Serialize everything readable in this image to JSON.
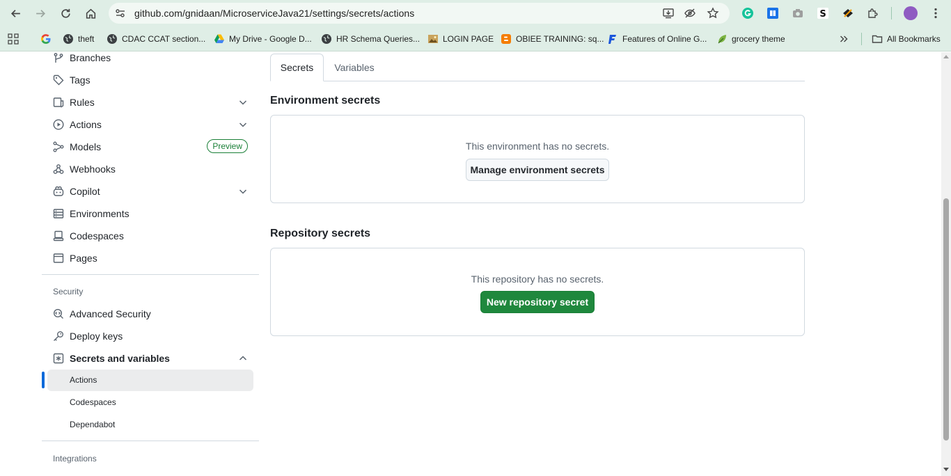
{
  "browser": {
    "url": "github.com/gnidaan/MicroserviceJava21/settings/secrets/actions",
    "accent_color": "#dfeee6",
    "bookmarks": [
      {
        "label": "",
        "icon": "google-icon"
      },
      {
        "label": "theft",
        "icon": "globe-icon"
      },
      {
        "label": "CDAC CCAT section...",
        "icon": "globe-icon"
      },
      {
        "label": "My Drive - Google D...",
        "icon": "google-drive-icon"
      },
      {
        "label": "HR Schema Queries...",
        "icon": "globe-icon"
      },
      {
        "label": "LOGIN PAGE",
        "icon": "image-icon"
      },
      {
        "label": "OBIEE TRAINING: sq...",
        "icon": "blogger-icon"
      },
      {
        "label": "Features of Online G...",
        "icon": "f-logo-icon"
      },
      {
        "label": "grocery theme",
        "icon": "leaf-icon"
      }
    ],
    "all_bookmarks": "All Bookmarks"
  },
  "sidebar": {
    "items": [
      {
        "label": "Branches",
        "icon": "branch-icon"
      },
      {
        "label": "Tags",
        "icon": "tag-icon"
      },
      {
        "label": "Rules",
        "icon": "rules-icon"
      },
      {
        "label": "Actions",
        "icon": "play-icon"
      },
      {
        "label": "Models",
        "icon": "models-icon",
        "badge": "Preview"
      },
      {
        "label": "Webhooks",
        "icon": "webhook-icon"
      },
      {
        "label": "Copilot",
        "icon": "copilot-icon"
      },
      {
        "label": "Environments",
        "icon": "server-icon"
      },
      {
        "label": "Codespaces",
        "icon": "codespaces-icon"
      },
      {
        "label": "Pages",
        "icon": "browser-icon"
      }
    ],
    "security_heading": "Security",
    "security_items": [
      {
        "label": "Advanced Security",
        "icon": "codescan-icon"
      },
      {
        "label": "Deploy keys",
        "icon": "key-icon"
      },
      {
        "label": "Secrets and variables",
        "icon": "asterisk-icon"
      }
    ],
    "secrets_sub": [
      {
        "label": "Actions",
        "active": true
      },
      {
        "label": "Codespaces",
        "active": false
      },
      {
        "label": "Dependabot",
        "active": false
      }
    ],
    "integrations_heading": "Integrations"
  },
  "main": {
    "tabs": [
      {
        "label": "Secrets",
        "selected": true
      },
      {
        "label": "Variables",
        "selected": false
      }
    ],
    "environment": {
      "title": "Environment secrets",
      "message": "This environment has no secrets.",
      "button": "Manage environment secrets"
    },
    "repository": {
      "title": "Repository secrets",
      "message": "This repository has no secrets.",
      "button": "New repository secret"
    }
  }
}
